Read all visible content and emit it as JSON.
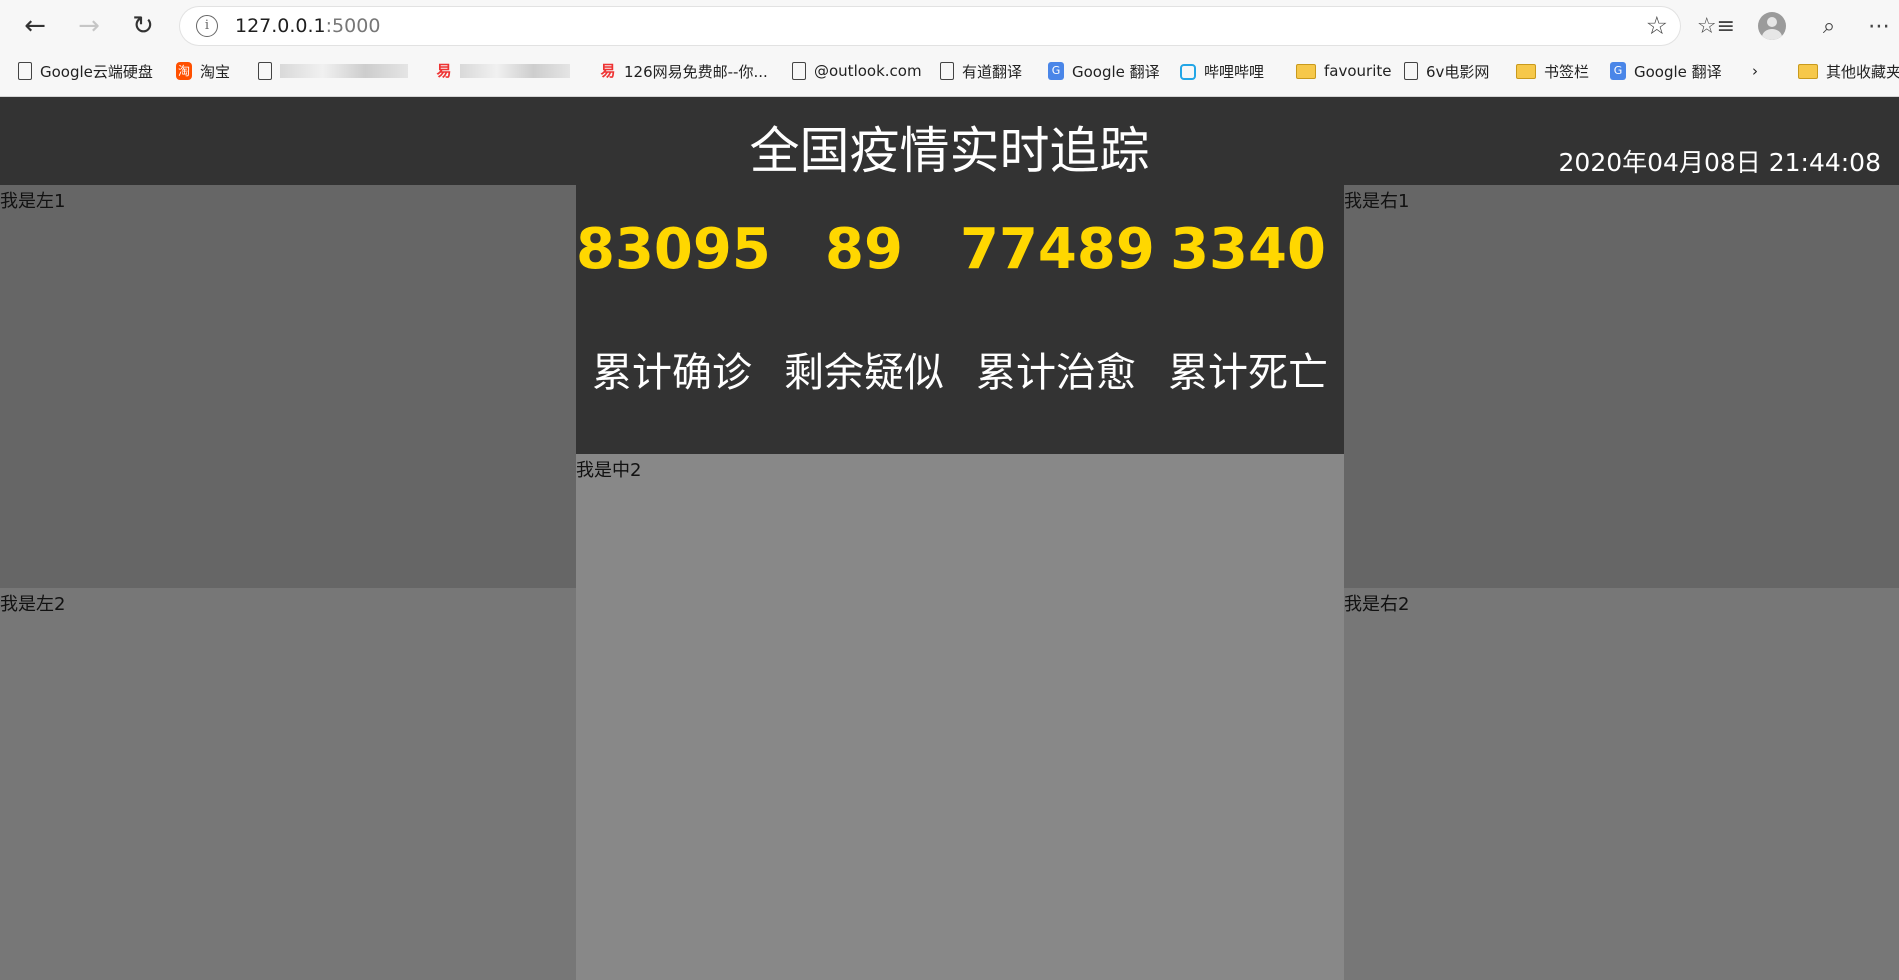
{
  "browser": {
    "url_host": "127.0.0.1",
    "url_port": ":5000",
    "bookmarks": [
      {
        "label": "Google云端硬盘",
        "icon": "page-icon"
      },
      {
        "label": "淘宝",
        "icon": "taobao-icon"
      },
      {
        "label": "",
        "icon": "page-icon"
      },
      {
        "label": "",
        "icon": "netease-icon"
      },
      {
        "label": "126网易免费邮--你...",
        "icon": "netease-icon"
      },
      {
        "label": "@outlook.com",
        "icon": "page-icon"
      },
      {
        "label": "有道翻译",
        "icon": "page-icon"
      },
      {
        "label": "Google 翻译",
        "icon": "google-translate-icon"
      },
      {
        "label": "哔哩哔哩",
        "icon": "bilibili-icon"
      },
      {
        "label": "favourite",
        "icon": "folder-icon"
      },
      {
        "label": "6v电影网",
        "icon": "page-icon"
      },
      {
        "label": "书签栏",
        "icon": "folder-icon"
      },
      {
        "label": "Google 翻译",
        "icon": "google-translate-icon"
      },
      {
        "label": "其他收藏夹",
        "icon": "folder-icon"
      }
    ]
  },
  "header": {
    "title": "全国疫情实时追踪",
    "time": "2020年04月08日 21:44:08"
  },
  "stats": [
    {
      "value": "83095",
      "label": "累计确诊"
    },
    {
      "value": "89",
      "label": "剩余疑似"
    },
    {
      "value": "77489",
      "label": "累计治愈"
    },
    {
      "value": "3340",
      "label": "累计死亡"
    }
  ],
  "panels": {
    "left1": "我是左1",
    "left2": "我是左2",
    "center2": "我是中2",
    "right1": "我是右1",
    "right2": "我是右2"
  },
  "colors": {
    "title_bar_bg": "#333333",
    "stat_number": "#ffd700",
    "panel_dark": "#666666",
    "panel_mid": "#777777",
    "panel_light": "#888888"
  }
}
